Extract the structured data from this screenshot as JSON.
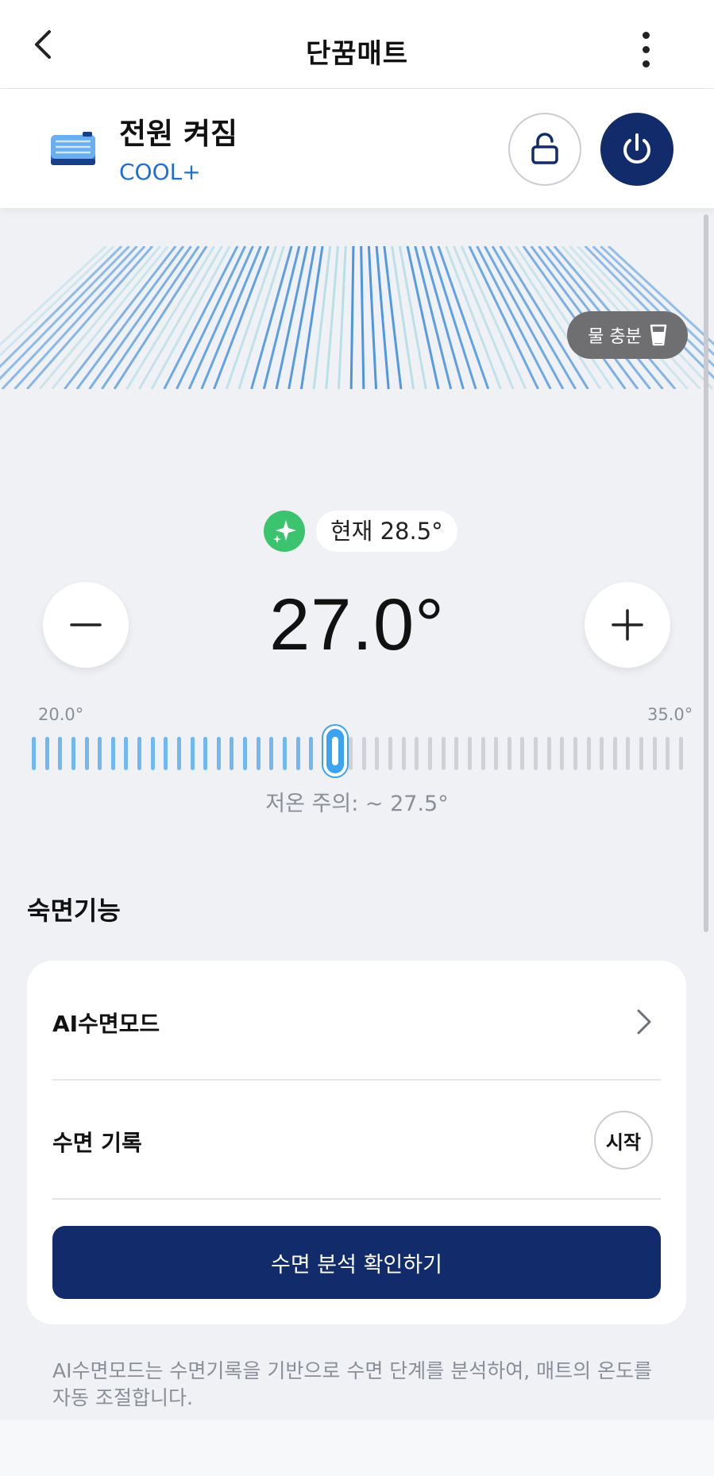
{
  "appbar": {
    "title": "단꿈매트",
    "back_icon": "chevron-left-icon",
    "more_icon": "more-vertical-icon"
  },
  "status": {
    "power_text": "전원 켜짐",
    "mode": "COOL+",
    "device_icon": "mat-icon",
    "lock_icon": "unlock-icon",
    "power_icon": "power-icon",
    "colors": {
      "accent": "#122b6b",
      "mode": "#1f6fd1"
    }
  },
  "water_badge": {
    "label": "물 충분",
    "icon": "water-cup-icon"
  },
  "temperature": {
    "current_label": "현재 28.5°",
    "setpoint": "27.0°",
    "min_label": "20.0°",
    "max_label": "35.0°",
    "min": 20.0,
    "max": 35.0,
    "value": 27.0,
    "warning": "저온 주의: ~ 27.5°",
    "colors": {
      "active": "#6fb8f2",
      "inactive": "#cfd1d6",
      "thumb": "#3ba3f0"
    }
  },
  "sleep": {
    "section_title": "숙면기능",
    "ai_mode_label": "AI수면모드",
    "record_label": "수면 기록",
    "start_label": "시작",
    "analysis_button": "수면 분석 확인하기",
    "footnote": "AI수면모드는 수면기록을 기반으로 수면 단계를 분석하여, 매트의 온도를 자동 조절합니다."
  }
}
